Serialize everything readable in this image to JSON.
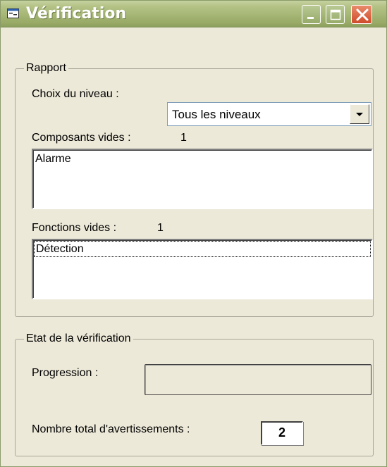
{
  "window": {
    "title": "Vérification"
  },
  "titlebar_buttons": [
    "minimize-icon",
    "maximize-icon",
    "close-icon"
  ],
  "rapport": {
    "legend": "Rapport",
    "level_label": "Choix du niveau :",
    "level_value": "Tous les niveaux",
    "components_label": "Composants vides :",
    "components_count": "1",
    "components_items": [
      "Alarme"
    ],
    "functions_label": "Fonctions vides :",
    "functions_count": "1",
    "functions_items": [
      "Détection"
    ]
  },
  "etat": {
    "legend": "Etat de la vérification",
    "progress_label": "Progression :",
    "progress_fraction": 0,
    "warnings_label": "Nombre total d'avertissements :",
    "warnings_count": "2"
  },
  "colors": {
    "window_bg": "#ece9d8",
    "titlebar": "#a5b675",
    "close_button": "#cf4b2a"
  }
}
